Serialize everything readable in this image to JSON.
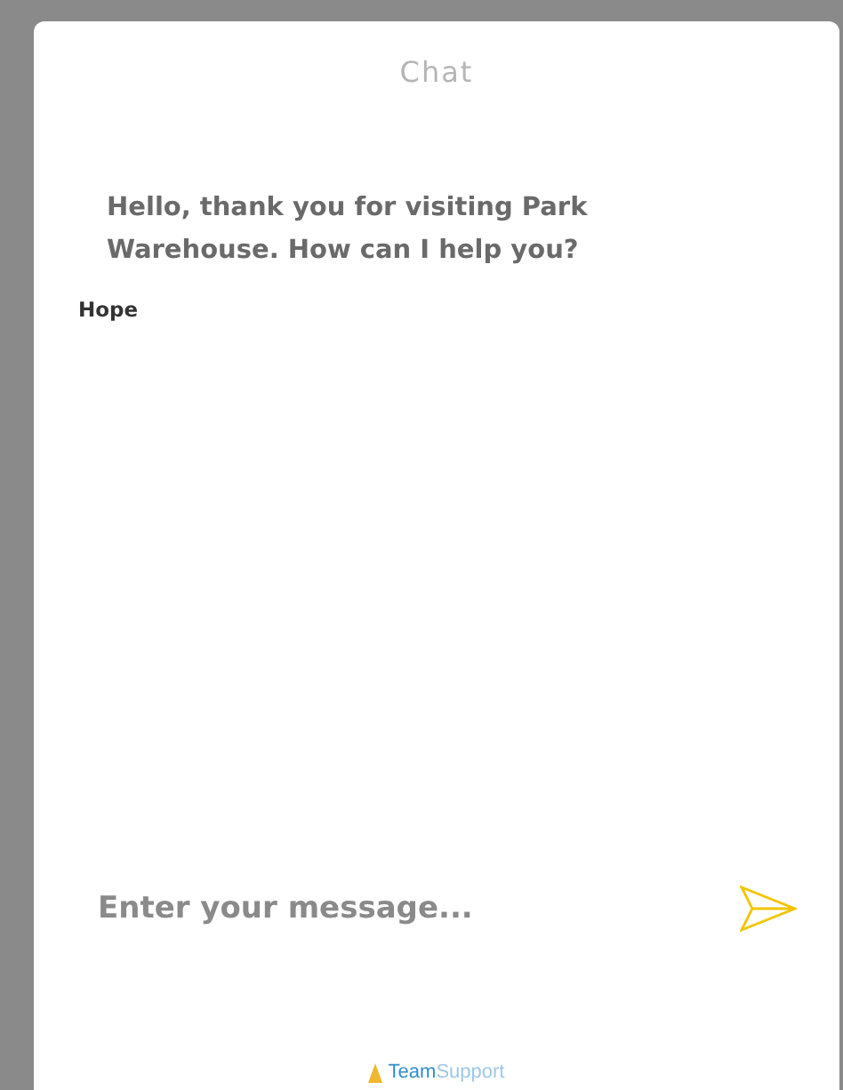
{
  "window": {
    "title": "Chat"
  },
  "messages": [
    {
      "text": "Hello, thank you for visiting Park Warehouse. How can I help you?",
      "sender": "Hope"
    }
  ],
  "composer": {
    "placeholder": "Enter your message..."
  },
  "footer": {
    "brand_first": "Team",
    "brand_second": "Support"
  }
}
